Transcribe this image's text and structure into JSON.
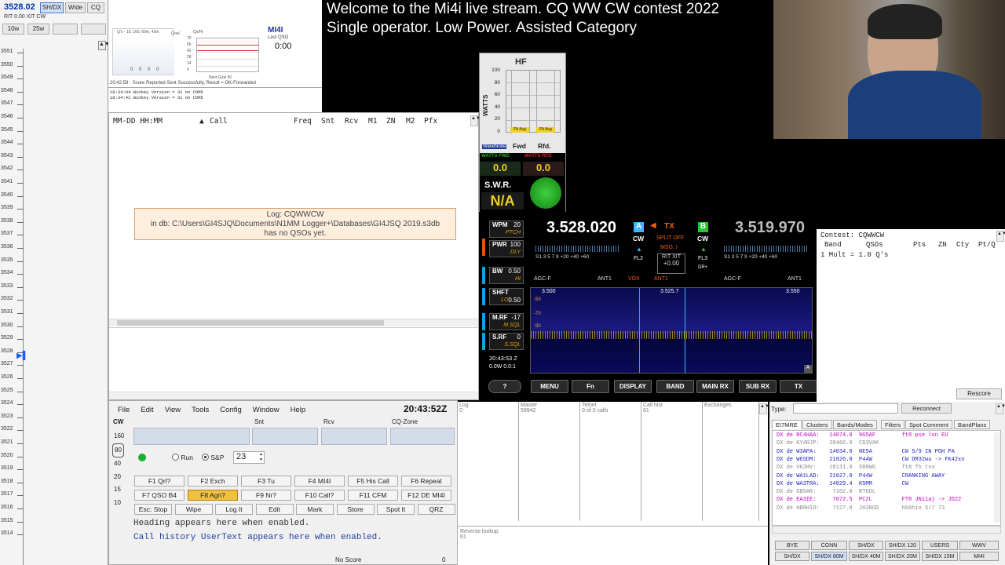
{
  "bandmap": {
    "freq": "3528.02",
    "mode_btns": [
      "SH/DX",
      "Wide",
      "CQ"
    ],
    "rit": "RIT",
    "rit_val": "0.00",
    "xit": "XIT",
    "cw": "CW",
    "step_btns": [
      "10w",
      "25w"
    ],
    "ticks": [
      "3551",
      "3550",
      "3549",
      "3548",
      "3547",
      "3546",
      "3545",
      "3544",
      "3543",
      "3542",
      "3541",
      "3540",
      "3539",
      "3538",
      "3537",
      "3536",
      "3535",
      "3534",
      "3533",
      "3532",
      "3531",
      "3530",
      "3529",
      "3528",
      "3527",
      "3526",
      "3525",
      "3524",
      "3523",
      "3522",
      "3521",
      "3520",
      "3519",
      "3518",
      "3517",
      "3516",
      "3515",
      "3514"
    ]
  },
  "score": {
    "header": "- Q's - 10, 160, 60m, 43m",
    "goal": "Goal",
    "graph_vals": [
      "0",
      "0",
      "0",
      "0"
    ],
    "qs_hr": "Qs/Hr",
    "yvals": [
      "70",
      "56",
      "42",
      "28",
      "14",
      "0"
    ],
    "call": "MI4I",
    "last_qso_lbl": "Last QSO",
    "last_qso": "0:00",
    "next_goal": "Next Goal 50",
    "status": "20:42:59 - Score Reported Sent Successfully, Result = OK-Forwarded",
    "winkey": [
      "18:34:04 Winkey Version = 31 on COM5",
      "18:34:42 Winkey Version = 31 on COM5"
    ]
  },
  "title": {
    "line1": "Welcome to the Mi4i live stream. CQ WW CW contest 2022",
    "line2": "Single operator. Low Power. Assisted Category"
  },
  "log": {
    "columns": [
      "MM-DD HH:MM",
      "Call",
      "Freq",
      "Snt",
      "Rcv",
      "M1",
      "ZN",
      "M2",
      "Pfx"
    ],
    "msg1": "Log: CQWWCW",
    "msg2": "in db: C:\\Users\\GI4SJQ\\Documents\\N1MM Logger+\\Databases\\GI4JSQ 2019.s3db",
    "msg3": "has no QSOs yet."
  },
  "entry": {
    "menu": [
      "File",
      "Edit",
      "View",
      "Tools",
      "Config",
      "Window",
      "Help"
    ],
    "clock": "20:43:52Z",
    "mode": "CW",
    "fields": [
      "Snt",
      "Rcv",
      "CQ-Zone"
    ],
    "bands": [
      "160",
      "80",
      "40",
      "20",
      "15",
      "10"
    ],
    "run": "Run",
    "sp": "S&P",
    "zone": "23",
    "fkeys": [
      "F1 Qrl?",
      "F2 Exch",
      "F3 Tu",
      "F4 MI4I",
      "F5 His Call",
      "F6 Repeat",
      "F7 QSO B4",
      "F8 Agn?",
      "F9 Nr?",
      "F10 Call?",
      "F11 CFM",
      "F12 DE MI4I",
      "Esc: Stop",
      "Wipe",
      "Log It",
      "Edit",
      "Mark",
      "Store",
      "Spot It",
      "QRZ"
    ],
    "heading": "Heading appears here when enabled.",
    "callhist": "Call history UserText appears here when enabled.",
    "score": "No Score",
    "score_val": "0"
  },
  "watt": {
    "title": "HF",
    "scale": [
      "100",
      "80",
      "60",
      "40",
      "20",
      "0"
    ],
    "ylabel": "WATTS",
    "pk": [
      "Pk Avg",
      "Pk Avg"
    ],
    "fwd": "Fwd",
    "rfd": "Rfd.",
    "brand": "WaveNode",
    "lbl_fwd": "WATTS FWD",
    "lbl_rfd": "WATTS RFD",
    "val_fwd": "0.0",
    "val_rfd": "0.0",
    "swr": "S.W.R.",
    "swr_val": "N/A"
  },
  "radio": {
    "freq_a": "3.528.020",
    "freq_b": "3.519.970",
    "vfo_a": "A",
    "vfo_b": "B",
    "tx": "TX",
    "mode_a": "CW",
    "mode_b": "CW",
    "split": "SPLIT OFF",
    "msg": "MSG: I",
    "rit": "RIT XIT",
    "rit_val": "+0.00",
    "fl_a": "FL2",
    "fl_b": "FL3",
    "drp": "DR+",
    "side": [
      {
        "k": "WPM",
        "v": "20",
        "s": "PTCH"
      },
      {
        "k": "PWR",
        "v": "100",
        "s": "DLY"
      },
      {
        "k": "BW",
        "v": "0.50",
        "s": "HI"
      },
      {
        "k": "SHFT",
        "v": "0.50",
        "s": "LO"
      },
      {
        "k": "M.RF",
        "v": "-17",
        "s": "M.SQL"
      },
      {
        "k": "S.RF",
        "v": "0",
        "s": "S.SQL"
      }
    ],
    "smeter": "S1 3 5 7 9 +20 +40 +60",
    "agc": "AGC-F",
    "ant": "ANT1",
    "vox": "VOX",
    "scope_l": "3.500",
    "scope_c": "3.525.7",
    "scope_r": "3.550",
    "db": [
      "-50",
      "-70",
      "-90"
    ],
    "utc": "20:43:53 Z",
    "pwr": "0.0W 0.0:1",
    "buttons": [
      "?",
      "MENU",
      "Fn",
      "DISPLAY",
      "BAND",
      "MAIN RX",
      "SUB RX",
      "TX"
    ]
  },
  "mult": {
    "contest": "Contest: CQWWCW",
    "cols": [
      "Band",
      "QSOs",
      "Pts",
      "ZN",
      "Cty",
      "Pt/Q"
    ],
    "row": "1 Mult = 1.0 Q's",
    "rescore": "Rescore"
  },
  "panes": {
    "labels": [
      "Log",
      "Master",
      "Telnet",
      "Call hist",
      "Exchanges"
    ],
    "vals": [
      "0",
      "59942",
      "0 of 0 calls",
      "61",
      ""
    ],
    "rev": "Reverse lookup",
    "rev_val": "61"
  },
  "telnet": {
    "type_lbl": "Type:",
    "reconnect": "Reconnect",
    "tabs": [
      "EI7MRE",
      "Clusters",
      "Bands/Modes",
      "Filters",
      "Spot Comment",
      "BandPlans"
    ],
    "spots": [
      {
        "t": "DX de RC4HAA:   14074.0  9G5AF        ft8 pse lsn EU",
        "c": "#c000c0"
      },
      {
        "t": "DX de KY4RJP:   28466.0  CD3VAK",
        "c": "#888"
      },
      {
        "t": "DX de W3APA:    14034.0  NE5A         CW 5/9 IN PGH PA",
        "c": "#2020c0"
      },
      {
        "t": "DX de W6SDM:    21026.0  P44W         CW DM32wu -> FK42xn",
        "c": "#2020c0"
      },
      {
        "t": "DX de VK2HV:    10131.0  5R8WG        ft8 fh tnx",
        "c": "#888"
      },
      {
        "t": "DX de WA1LAD:   21027.0  P44W         CRANKING AWAY",
        "c": "#2020c0"
      },
      {
        "t": "DX de WA3TRA:   14029.4  K5MM         CW",
        "c": "#2020c0"
      },
      {
        "t": "DX de DB5AR:     7102.0  RT6DL",
        "c": "#888"
      },
      {
        "t": "DX de EA3IE:     7072.5  PC2L         FT8 JN11aj -> JO22",
        "c": "#c000c0"
      },
      {
        "t": "DX de HB9HIO:    7127.0  JH3NGD       hb9hio 5/7 73",
        "c": "#888"
      }
    ],
    "cmds1": [
      "BYE",
      "CONN",
      "SH/DX",
      "SH/DX 120",
      "USERS",
      "WWV"
    ],
    "cmds2": [
      "SH/DX",
      "SH/DX 80M",
      "SH/DX 40M",
      "SH/DX 20M",
      "SH/DX 15M",
      "MI4I"
    ]
  }
}
